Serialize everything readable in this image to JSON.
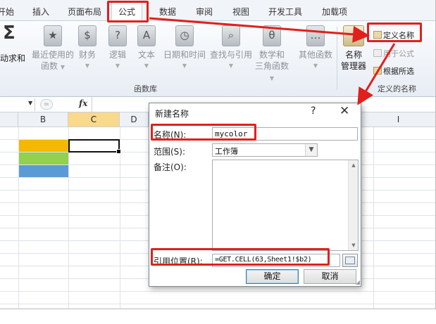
{
  "ribbon_tabs": [
    {
      "label": "开始",
      "active": false
    },
    {
      "label": "插入",
      "active": false
    },
    {
      "label": "页面布局",
      "active": false
    },
    {
      "label": "公式",
      "active": true
    },
    {
      "label": "数据",
      "active": false
    },
    {
      "label": "审阅",
      "active": false
    },
    {
      "label": "视图",
      "active": false
    },
    {
      "label": "开发工具",
      "active": false
    },
    {
      "label": "加载项",
      "active": false
    }
  ],
  "ribbon": {
    "autosum": {
      "line1": "动求和",
      "icon": "sigma-icon"
    },
    "buttons": [
      {
        "line1": "最近使用的",
        "line2": "函数",
        "glyph": "★"
      },
      {
        "line1": "财务",
        "line2": "",
        "glyph": "$"
      },
      {
        "line1": "逻辑",
        "line2": "",
        "glyph": "?"
      },
      {
        "line1": "文本",
        "line2": "",
        "glyph": "A"
      },
      {
        "line1": "日期和时间",
        "line2": "",
        "glyph": "◷"
      },
      {
        "line1": "查找与引用",
        "line2": "",
        "glyph": "⌕"
      },
      {
        "line1": "数学和",
        "line2": "三角函数",
        "glyph": "θ"
      },
      {
        "line1": "其他函数",
        "line2": "",
        "glyph": "…"
      }
    ],
    "group_function_library": "函数库",
    "name_manager": {
      "line1": "名称",
      "line2": "管理器"
    },
    "define_name": "定义名称",
    "use_in_formula": "用于公式",
    "create_from_selection": "根据所选",
    "group_defined_names": "定义的名称"
  },
  "formula_bar": {
    "name_box": "",
    "fx": "fx"
  },
  "columns": [
    {
      "label": "B",
      "selected": false
    },
    {
      "label": "C",
      "selected": true
    },
    {
      "label": "D",
      "selected": false
    },
    {
      "label": "I",
      "selected": false
    }
  ],
  "cell_fills": {
    "b2": "#f5b800",
    "b3": "#92d050",
    "b4": "#5b9bd5"
  },
  "dialog": {
    "title": "新建名称",
    "help": "?",
    "close": "✕",
    "name_label": "名称(N):",
    "name_value": "mycolor",
    "scope_label": "范围(S):",
    "scope_value": "工作簿",
    "comment_label": "备注(O):",
    "refers_to_label": "引用位置(R):",
    "refers_to_value": "=GET.CELL(63,Sheet1!$b2)",
    "ok_label": "确定",
    "cancel_label": "取消"
  },
  "annotation_color": "#e0201c"
}
